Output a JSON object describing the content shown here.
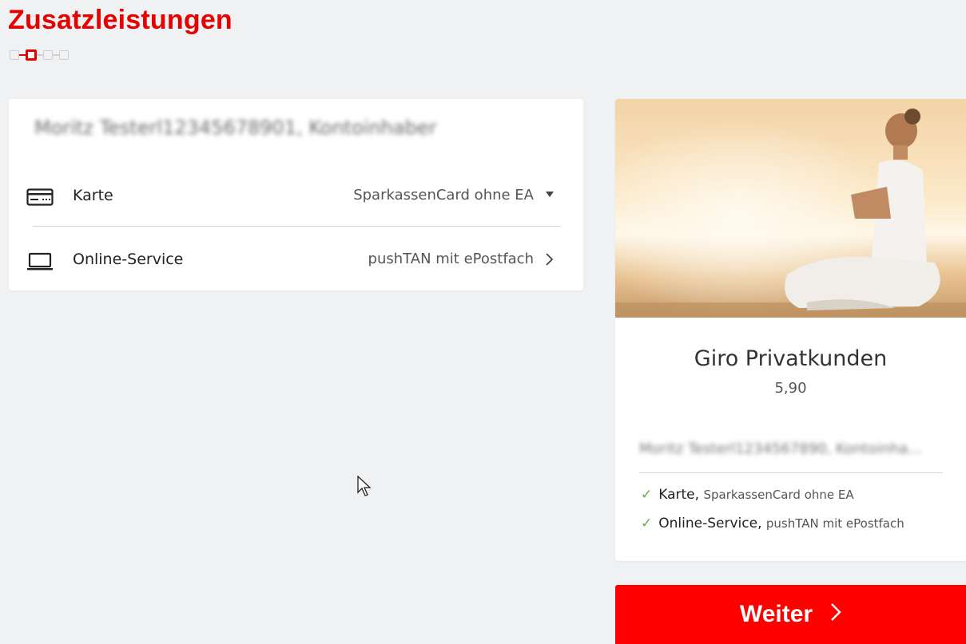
{
  "page": {
    "title": "Zusatzleistungen"
  },
  "stepper": {
    "total": 4,
    "active_index": 1
  },
  "account": {
    "holder_name": "Moritz Testerl12345678901, Kontoinhaber"
  },
  "options": {
    "card": {
      "label": "Karte",
      "value": "SparkassenCard ohne EA",
      "control_icon": "triangle-down-icon",
      "icon": "credit-card-icon"
    },
    "online_service": {
      "label": "Online-Service",
      "value": "pushTAN mit ePostfach",
      "control_icon": "chevron-right-icon",
      "icon": "laptop-icon"
    }
  },
  "summary": {
    "image_alt": "Frau in Meditationshaltung am Strand",
    "product_name": "Giro Privatkunden",
    "price": "5,90",
    "holder_name": "Moritz Testerl1234567890, Kontoinha...",
    "features": [
      {
        "name": "Karte",
        "detail": "SparkassenCard ohne EA"
      },
      {
        "name": "Online-Service",
        "detail": "pushTAN mit ePostfach"
      }
    ]
  },
  "actions": {
    "next_label": "Weiter",
    "next_icon": "chevron-right-icon"
  },
  "colors": {
    "brand_red": "#e60000",
    "button_red": "#fe0000",
    "background": "#eff1f3",
    "check_green": "#6aa84f"
  }
}
